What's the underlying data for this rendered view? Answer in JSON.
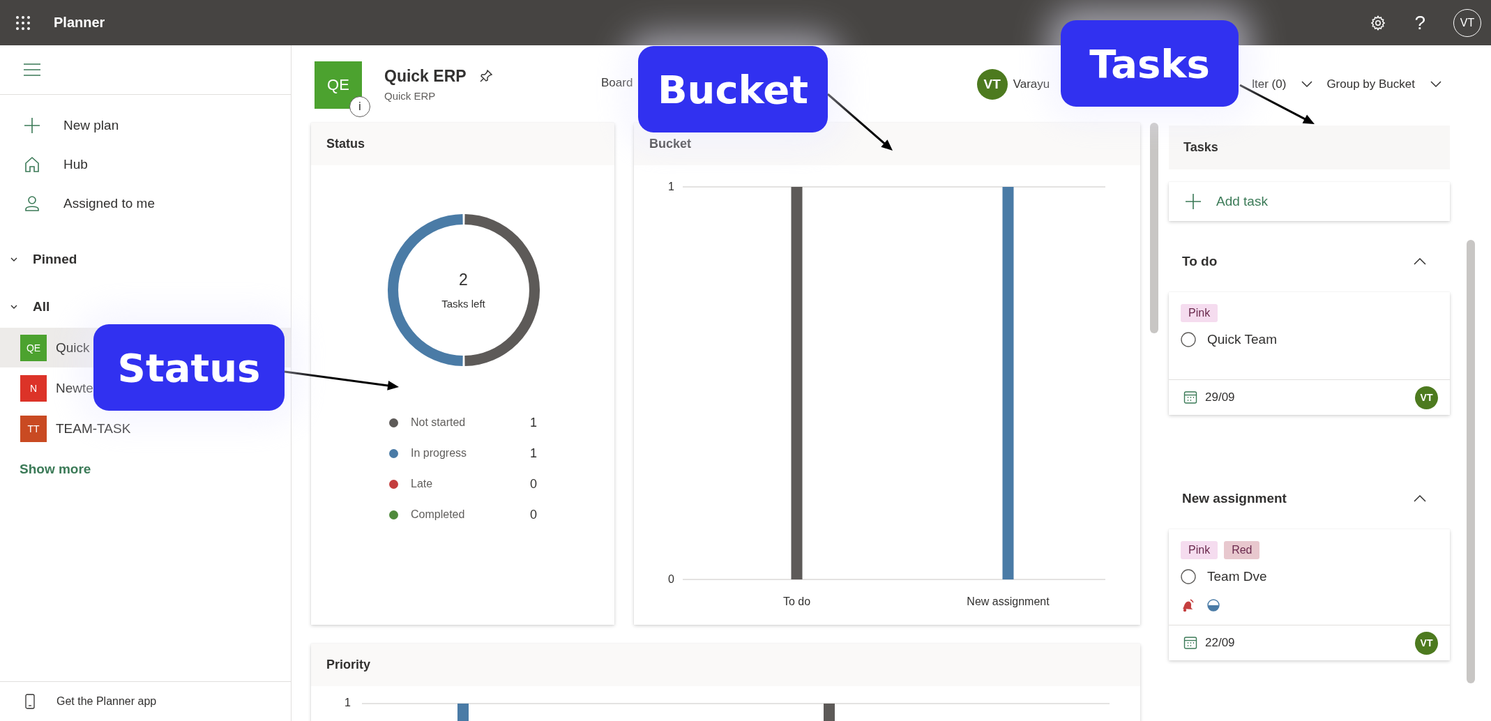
{
  "app_bar": {
    "title": "Planner",
    "help": "?",
    "avatar": "VT"
  },
  "sidebar": {
    "nav": [
      {
        "label": "New plan",
        "kind": "new"
      },
      {
        "label": "Hub",
        "kind": "hub"
      },
      {
        "label": "Assigned to me",
        "kind": "person"
      }
    ],
    "sections": [
      {
        "label": "Pinned",
        "expanded": true
      },
      {
        "label": "All",
        "expanded": true
      }
    ],
    "plans": [
      {
        "initials": "QE",
        "label": "Quick",
        "color": "#4ca22f",
        "selected": true
      },
      {
        "initials": "N",
        "label": "Newte",
        "color": "#dc3328",
        "selected": false
      },
      {
        "initials": "TT",
        "label": "TEAM-TASK",
        "color": "#c94a22",
        "selected": false
      }
    ],
    "show_more": "Show more",
    "footer": "Get the Planner app"
  },
  "plan_header": {
    "initials": "QE",
    "info": "i",
    "title": "Quick ERP",
    "subtitle": "Quick ERP",
    "view": "Board",
    "member": {
      "initials": "VT",
      "name": "Varayu"
    },
    "filter": "lter (0)",
    "group": "Group by Bucket"
  },
  "status_card": {
    "title": "Status",
    "count": "2",
    "count_label": "Tasks left",
    "chart_data": {
      "type": "donut",
      "values": [
        50,
        50
      ],
      "colors": [
        "#5d5a58",
        "#4a7ba6"
      ]
    },
    "legend": [
      {
        "label": "Not started",
        "count": "1",
        "color": "#5d5a58"
      },
      {
        "label": "In progress",
        "count": "1",
        "color": "#4a7ba6"
      },
      {
        "label": "Late",
        "count": "0",
        "color": "#c43e3e"
      },
      {
        "label": "Completed",
        "count": "0",
        "color": "#4f8a3c"
      }
    ]
  },
  "bucket_card": {
    "title": "Bucket",
    "chart_data": {
      "type": "bar",
      "categories": [
        "To do",
        "New assignment"
      ],
      "ylim": [
        0,
        1
      ],
      "yticks": [
        0,
        1
      ],
      "series": [
        {
          "color": "#5d5a58",
          "values": [
            1,
            null
          ]
        },
        {
          "color": "#4a7ba6",
          "values": [
            null,
            1
          ]
        }
      ]
    }
  },
  "priority_card": {
    "title": "Priority",
    "y_tick": "1"
  },
  "tasks_panel": {
    "title": "Tasks",
    "add_task": "Add task",
    "buckets": [
      {
        "name": "To do",
        "expanded": true,
        "tasks": [
          {
            "tags": [
              {
                "label": "Pink",
                "color": "#f5dcef"
              }
            ],
            "title": "Quick Team",
            "completed": false,
            "due": "29/09",
            "assignee": "VT"
          }
        ]
      },
      {
        "name": "New assignment",
        "expanded": true,
        "tasks": [
          {
            "tags": [
              {
                "label": "Pink",
                "color": "#f5dcef"
              },
              {
                "label": "Red",
                "color": "#e8c8ce"
              }
            ],
            "title": "Team Dve",
            "completed": false,
            "indicators": [
              {
                "kind": "urgent"
              },
              {
                "kind": "in-progress"
              }
            ],
            "due": "22/09",
            "assignee": "VT"
          }
        ]
      }
    ]
  },
  "callouts": [
    {
      "label": "Bucket"
    },
    {
      "label": "Tasks"
    },
    {
      "label": "Status"
    }
  ]
}
